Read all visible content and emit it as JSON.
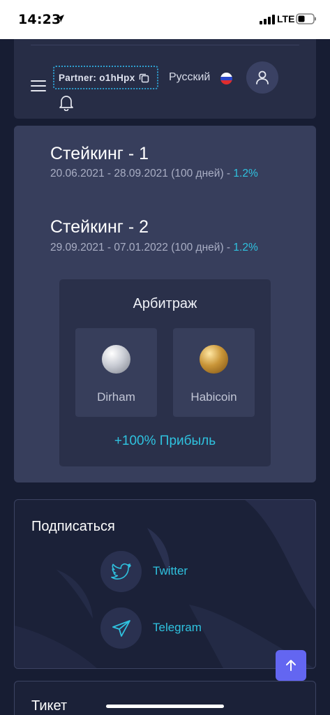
{
  "status": {
    "time": "14:23",
    "network": "LTE"
  },
  "header": {
    "partner_label": "Partner: o1hHpx",
    "language": "Русский"
  },
  "staking": [
    {
      "title": "Стейкинг - 1",
      "dates": "20.06.2021 - 28.09.2021 (100 дней) - ",
      "percent": "1.2%"
    },
    {
      "title": "Стейкинг - 2",
      "dates": "29.09.2021 - 07.01.2022 (100 дней) - ",
      "percent": "1.2%"
    }
  ],
  "arbitrage": {
    "title": "Арбитраж",
    "coins": [
      {
        "name": "Dirham"
      },
      {
        "name": "Habicoin"
      }
    ],
    "profit": "+100% Прибыль"
  },
  "subscribe": {
    "title": "Подписаться",
    "links": [
      {
        "label": "Twitter"
      },
      {
        "label": "Telegram"
      }
    ]
  },
  "ticket": {
    "title": "Тикет"
  },
  "colors": {
    "accent": "#2fc2df",
    "button": "#6366f1",
    "card": "#373e5c",
    "background": "#171d33"
  }
}
